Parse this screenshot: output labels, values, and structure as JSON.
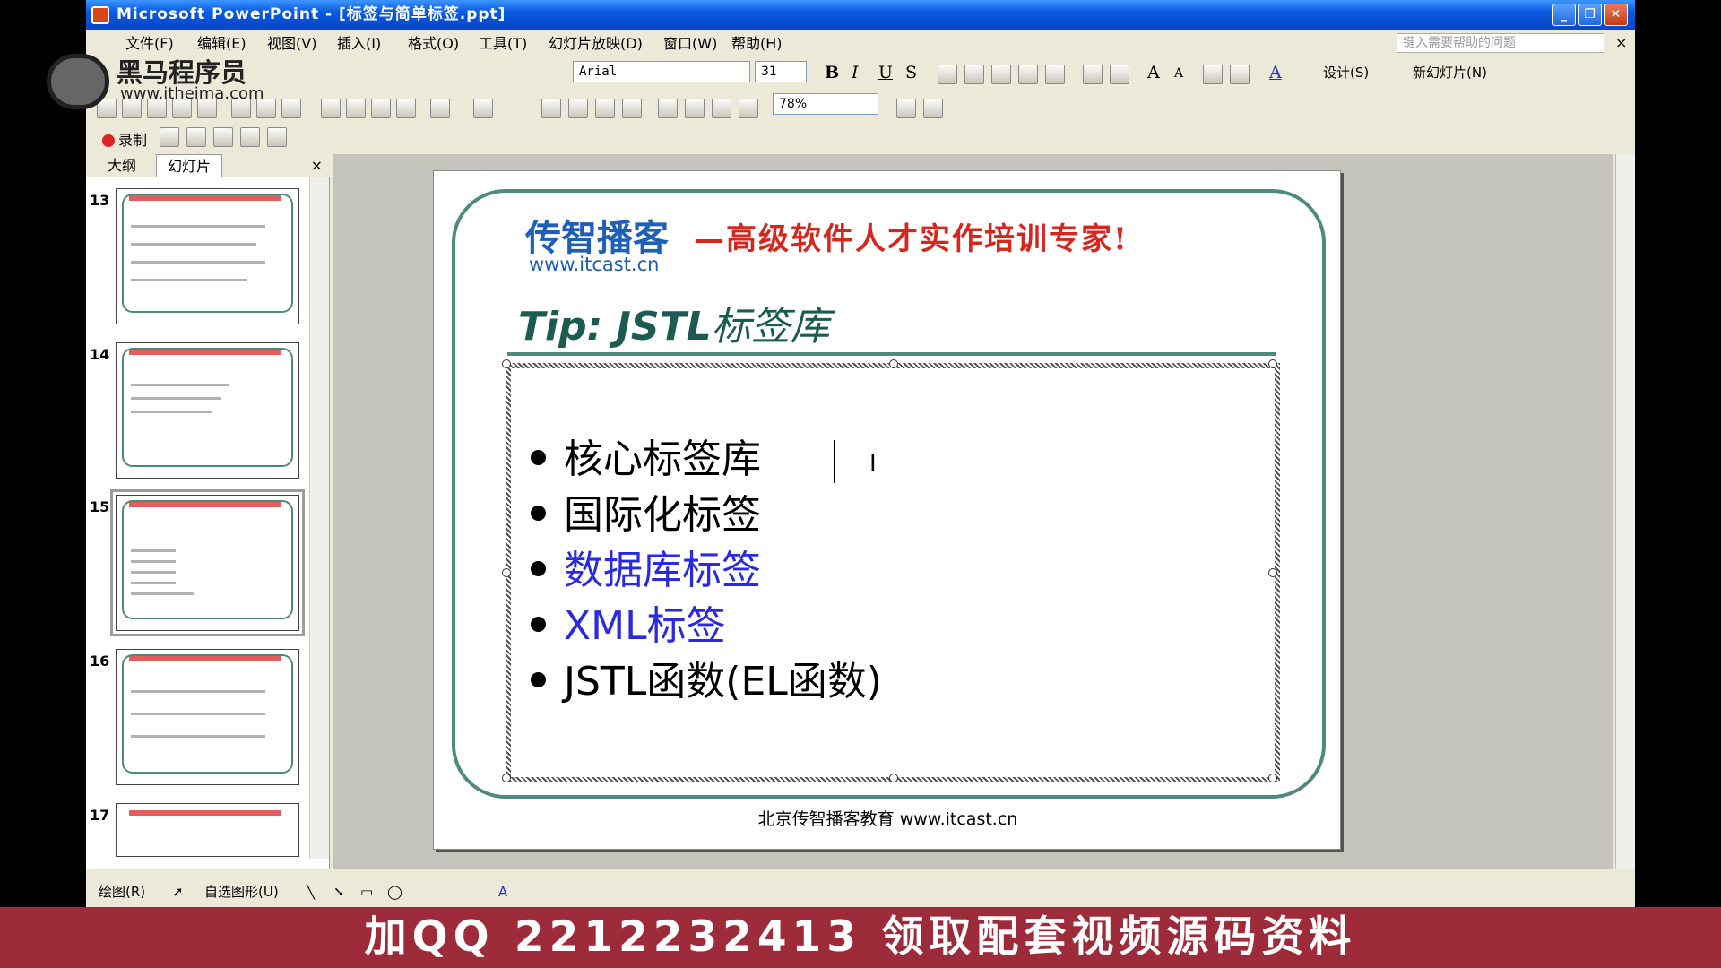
{
  "window": {
    "title": "Microsoft PowerPoint - [标签与简单标签.ppt]"
  },
  "menu": [
    "文件(F)",
    "编辑(E)",
    "视图(V)",
    "插入(I)",
    "格式(O)",
    "工具(T)",
    "幻灯片放映(D)",
    "窗口(W)",
    "帮助(H)"
  ],
  "help_placeholder": "键入需要帮助的问题",
  "toolbar": {
    "font": "Arial",
    "size": "31",
    "zoom": "78%",
    "design": "设计(S)",
    "new_slide": "新幻灯片(N)",
    "record": "录制"
  },
  "pane": {
    "tab_outline": "大纲",
    "tab_slides": "幻灯片",
    "close": "×",
    "slide_numbers": [
      "13",
      "14",
      "15",
      "16",
      "17"
    ],
    "selected": "15"
  },
  "slide": {
    "logo": "传智播客",
    "logo_url": "www.itcast.cn",
    "slogan": "—高级软件人才实作培训专家!",
    "title_a": "Tip: JSTL",
    "title_b": "标签库",
    "bullets": [
      {
        "text": "核心标签库",
        "color": "#000000"
      },
      {
        "text": "国际化标签",
        "color": "#000000"
      },
      {
        "text": "数据库标签",
        "color": "#2a2ae0"
      },
      {
        "text": "XML标签",
        "color": "#2a2ae0"
      },
      {
        "text": "JSTL函数(EL函数)",
        "color": "#000000"
      }
    ],
    "footer": "北京传智播客教育 www.itcast.cn"
  },
  "drawbar": {
    "draw": "绘图(R)",
    "autoshapes": "自选图形(U)"
  },
  "watermark": {
    "brand": "黑马程序员",
    "url": "www.itheima.com"
  },
  "banner": "加QQ 2212232413 领取配套视频源码资料"
}
